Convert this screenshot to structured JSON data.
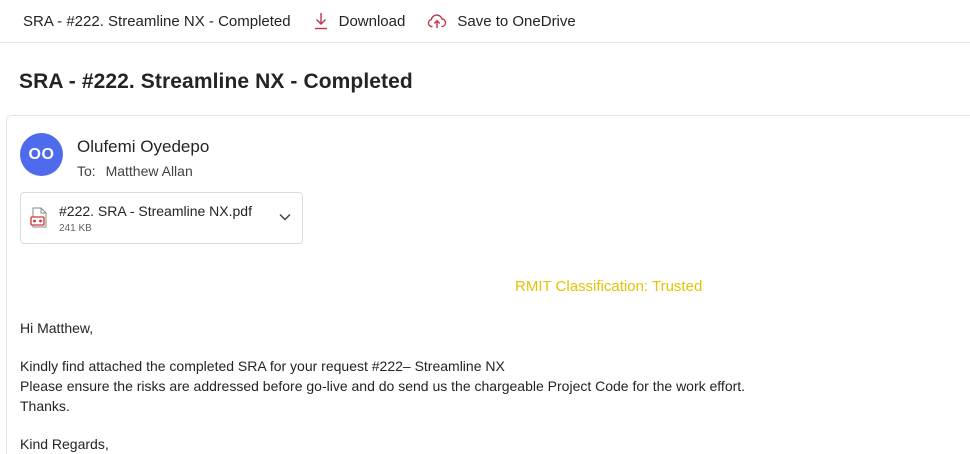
{
  "toolbar": {
    "title": "SRA - #222. Streamline NX - Completed",
    "download_label": "Download",
    "save_onedrive_label": "Save to OneDrive",
    "accent_color": "#c4314b"
  },
  "message": {
    "subject": "SRA - #222. Streamline NX - Completed",
    "sender_initials": "OO",
    "sender_name": "Olufemi Oyedepo",
    "to_label": "To:",
    "to_name": "Matthew Allan",
    "avatar_color": "#4f6bed"
  },
  "attachment": {
    "file_name": "#222. SRA - Streamline NX.pdf",
    "file_size": "241 KB",
    "icon": "pdf-file-icon"
  },
  "body": {
    "classification": "RMIT Classification: Trusted",
    "classification_color": "#e6c300",
    "greeting": "Hi Matthew,",
    "line1": "Kindly find attached the completed SRA for your request #222– Streamline NX",
    "line2": "Please ensure the risks are addressed before go-live and do send us the chargeable Project Code for the work effort.",
    "line3": "Thanks.",
    "closing": "Kind Regards,"
  }
}
